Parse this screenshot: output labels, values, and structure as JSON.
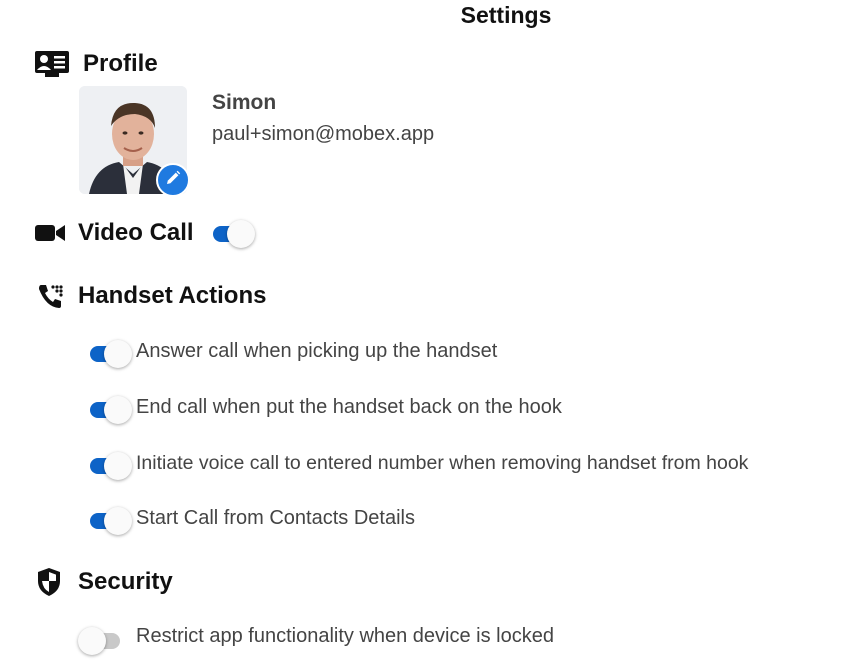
{
  "header": {
    "title": "Settings"
  },
  "profile": {
    "heading": "Profile",
    "name": "Simon",
    "email": "paul+simon@mobex.app"
  },
  "video_call": {
    "label": "Video Call",
    "enabled": true
  },
  "handset_actions": {
    "heading": "Handset Actions",
    "options": [
      {
        "label": "Answer call when picking up the handset",
        "enabled": true
      },
      {
        "label": "End call when put the handset back on the hook",
        "enabled": true
      },
      {
        "label": "Initiate voice call to entered number when removing handset from hook",
        "enabled": true
      },
      {
        "label": "Start Call from Contacts Details",
        "enabled": true
      }
    ]
  },
  "security": {
    "heading": "Security",
    "options": [
      {
        "label": "Restrict app functionality when device is locked",
        "enabled": false
      }
    ]
  },
  "colors": {
    "accent": "#0d63c7",
    "edit_badge": "#1f7ae0",
    "toggle_off": "#c9c9c9"
  }
}
